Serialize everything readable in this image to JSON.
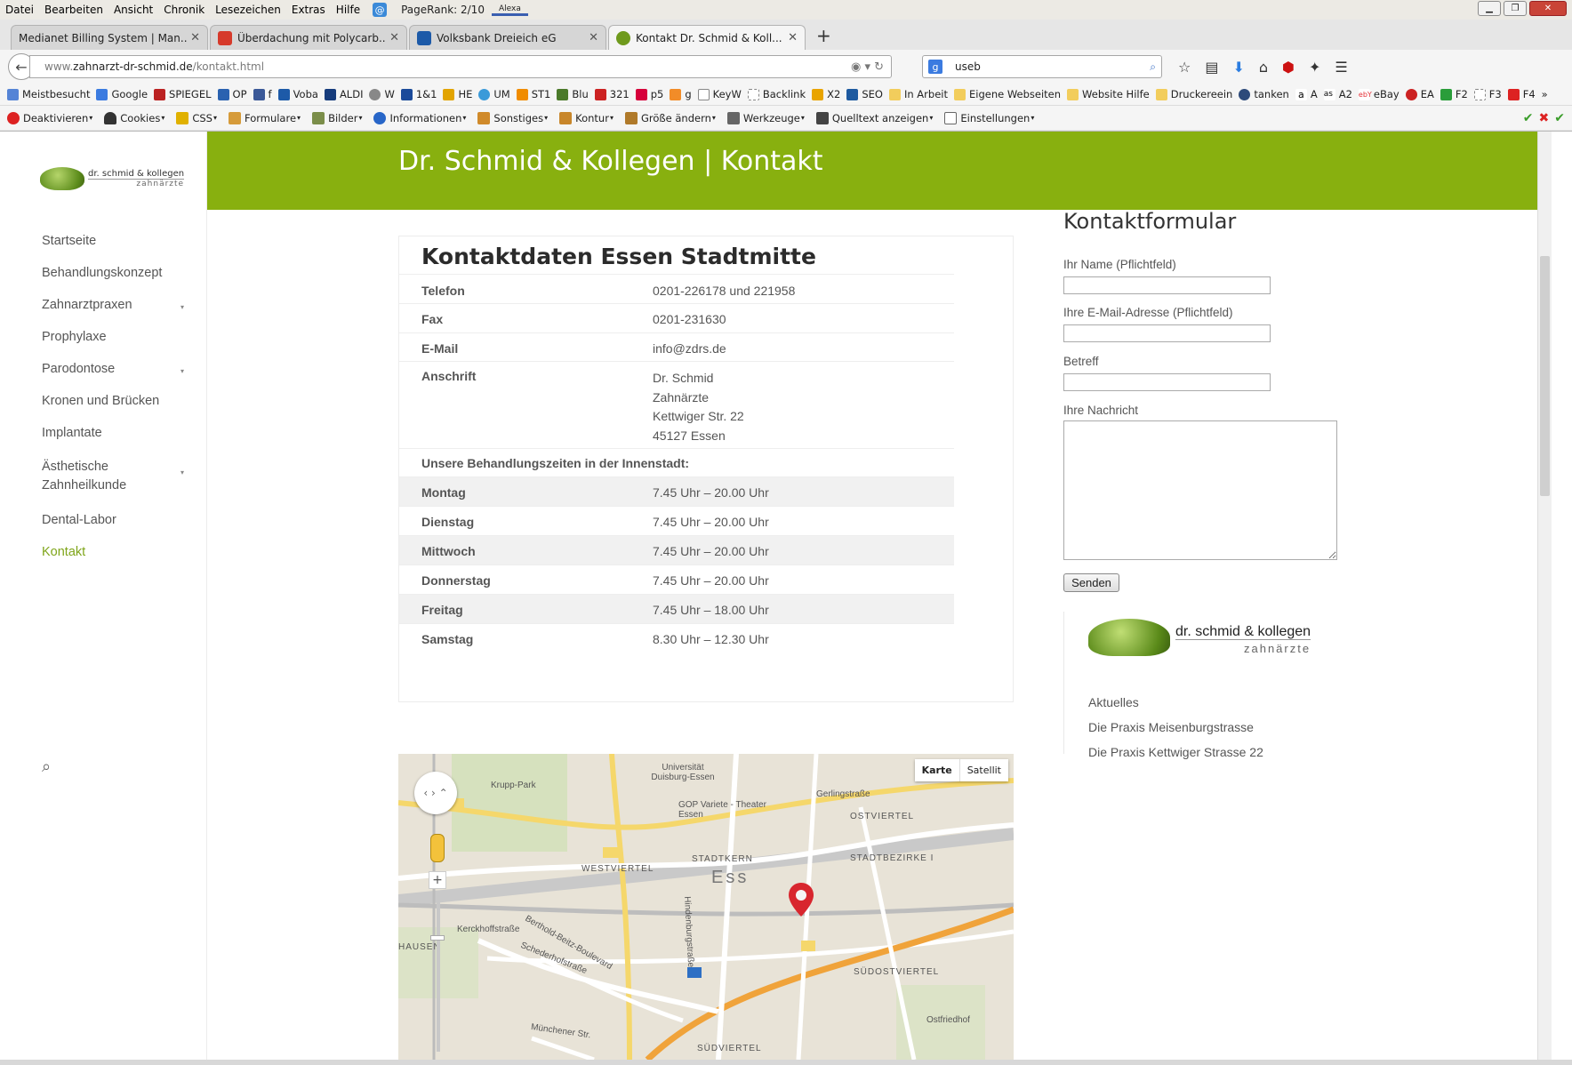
{
  "menubar": {
    "items": [
      "Datei",
      "Bearbeiten",
      "Ansicht",
      "Chronik",
      "Lesezeichen",
      "Extras",
      "Hilfe"
    ],
    "pagerank": "PageRank: 2/10",
    "alexa": "Alexa"
  },
  "tabs": [
    {
      "title": "Medianet Billing System | Man..."
    },
    {
      "title": "Überdachung mit Polycarb..."
    },
    {
      "title": "Volksbank Dreieich eG"
    },
    {
      "title": "Kontakt Dr. Schmid & Koll..."
    }
  ],
  "navbar": {
    "url_prefix": "www.",
    "url_domain": "zahnarzt-dr-schmid.de",
    "url_path": "/kontakt.html",
    "search_value": "useb"
  },
  "bookmarks": [
    "Meistbesucht",
    "Google",
    "SPIEGEL",
    "OP",
    "f",
    "Voba",
    "ALDI",
    "W",
    "1&1",
    "HE",
    "UM",
    "ST1",
    "Blu",
    "321",
    "p5",
    "g",
    "KeyW",
    "Backlink",
    "X2",
    "SEO",
    "In Arbeit",
    "Eigene Webseiten",
    "Website Hilfe",
    "Druckereein",
    "tanken",
    "A",
    "A2",
    "eBay",
    "EA",
    "F2",
    "F3",
    "F4"
  ],
  "toolbar": [
    "Deaktivieren",
    "Cookies",
    "CSS",
    "Formulare",
    "Bilder",
    "Informationen",
    "Sonstiges",
    "Kontur",
    "Größe ändern",
    "Werkzeuge",
    "Quelltext anzeigen",
    "Einstellungen"
  ],
  "sidebar": {
    "logo_line1": "dr. schmid & kollegen",
    "logo_line2": "zahnärzte",
    "items": [
      {
        "label": "Startseite"
      },
      {
        "label": "Behandlungskonzept"
      },
      {
        "label": "Zahnarztpraxen"
      },
      {
        "label": "Prophylaxe"
      },
      {
        "label": "Parodontose"
      },
      {
        "label": "Kronen und Brücken"
      },
      {
        "label": "Implantate"
      },
      {
        "label": "Ästhetische Zahnheilkunde"
      },
      {
        "label": "Dental-Labor"
      },
      {
        "label": "Kontakt"
      }
    ]
  },
  "header": {
    "title": "Dr. Schmid & Kollegen | Kontakt"
  },
  "contact": {
    "heading": "Kontaktdaten Essen Stadtmitte",
    "telefon_label": "Telefon",
    "telefon": "0201-226178 und 221958",
    "fax_label": "Fax",
    "fax": "0201-231630",
    "email_label": "E-Mail",
    "email": "info@zdrs.de",
    "address_label": "Anschrift",
    "address": [
      "Dr. Schmid",
      "Zahnärzte",
      "Kettwiger Str. 22",
      "45127 Essen"
    ],
    "hours_heading": "Unsere Behandlungszeiten in der Innenstadt:",
    "hours": [
      {
        "day": "Montag",
        "time": "7.45 Uhr – 20.00 Uhr"
      },
      {
        "day": "Dienstag",
        "time": "7.45 Uhr – 20.00 Uhr"
      },
      {
        "day": "Mittwoch",
        "time": "7.45 Uhr – 20.00 Uhr"
      },
      {
        "day": "Donnerstag",
        "time": "7.45 Uhr – 20.00 Uhr"
      },
      {
        "day": "Freitag",
        "time": "7.45 Uhr – 18.00 Uhr"
      },
      {
        "day": "Samstag",
        "time": "8.30 Uhr – 12.30 Uhr"
      }
    ]
  },
  "map": {
    "btn_map": "Karte",
    "btn_sat": "Satellit",
    "labels": [
      "Krupp-Park",
      "Universität Duisburg-Essen",
      "GOP Variete - Theater Essen",
      "Gerlingstraße",
      "OSTVIERTEL",
      "WESTVIERTEL",
      "STADTKERN",
      "Ess",
      "STADTBEZIRKE I",
      "Hindenburgstraße",
      "Berthold-Beitz-Boulevard",
      "Kerckhoffstraße",
      "Schederhofstraße",
      "SÜDOSTVIERTEL",
      "SÜDVIERTEL",
      "Ostfriedhof",
      "HAUSEN",
      "Münchener Str."
    ]
  },
  "form": {
    "title": "Kontaktformular",
    "name_label": "Ihr Name (Pflichtfeld)",
    "email_label": "Ihre E-Mail-Adresse (Pflichtfeld)",
    "subject_label": "Betreff",
    "message_label": "Ihre Nachricht",
    "submit": "Senden"
  },
  "widget": {
    "logo_line1": "dr. schmid & kollegen",
    "logo_line2": "zahnärzte",
    "links": [
      "Aktuelles",
      "Die Praxis Meisenburgstrasse",
      "Die Praxis Kettwiger Strasse 22"
    ]
  },
  "colors": {
    "accent": "#88b00f",
    "active_nav": "#7fa51a"
  }
}
